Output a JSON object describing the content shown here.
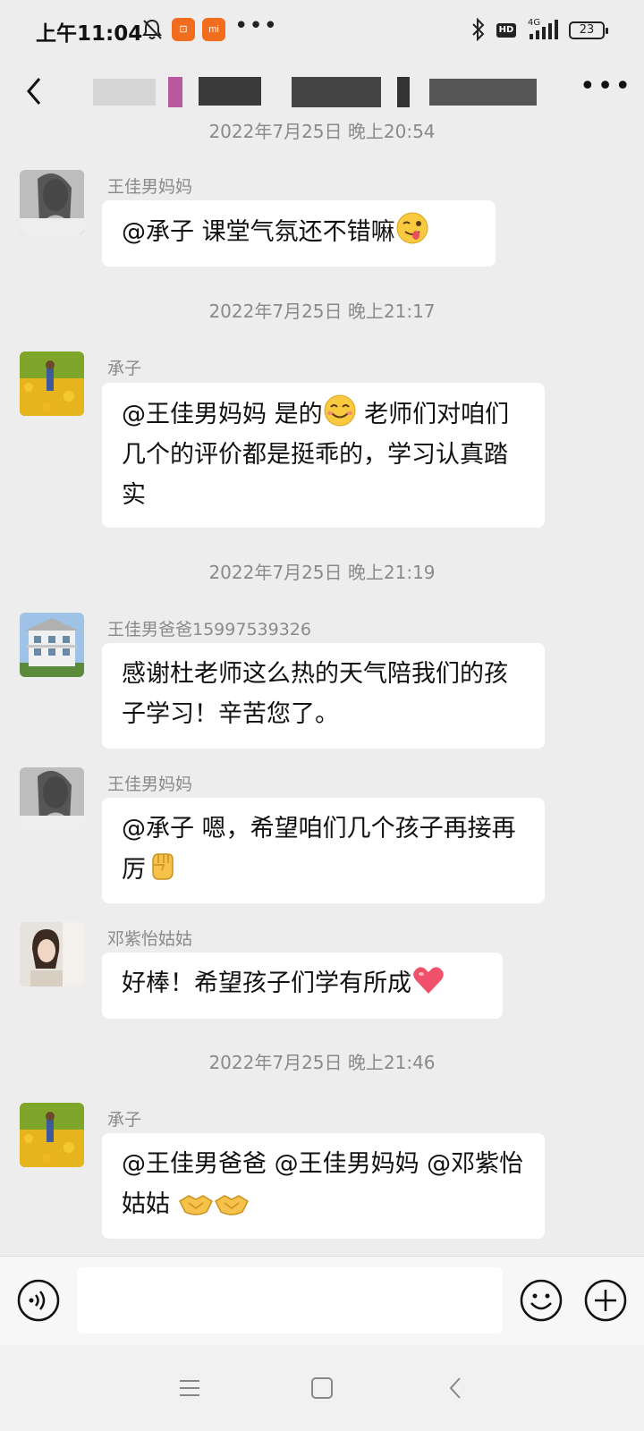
{
  "status_bar": {
    "time": "上午11:04",
    "shop_badge": "⊡",
    "mi_badge": "mi",
    "more": "•••",
    "hd": "HD",
    "network": "4G",
    "battery": "23"
  },
  "header": {
    "title": "",
    "more": "•••"
  },
  "messages": [
    {
      "type": "time",
      "text": "2022年7月25日 晚上20:54"
    },
    {
      "type": "msg",
      "sender": "王佳男妈妈",
      "text": "@承子  课堂气氛还不错嘛",
      "emoji": "wink-tongue-emoji"
    },
    {
      "type": "time",
      "text": "2022年7月25日 晚上21:17"
    },
    {
      "type": "msg",
      "sender": "承子",
      "text_before": "@王佳男妈妈  是的",
      "emoji": "smile-emoji",
      "text_after": "  老师们对咱们几个的评价都是挺乖的，学习认真踏实"
    },
    {
      "type": "time",
      "text": "2022年7月25日 晚上21:19"
    },
    {
      "type": "msg",
      "sender": "王佳男爸爸15997539326",
      "text": "感谢杜老师这么热的天气陪我们的孩子学习！辛苦您了。"
    },
    {
      "type": "msg",
      "sender": "王佳男妈妈",
      "text": "@承子  嗯，希望咱们几个孩子再接再厉",
      "emoji": "fist-emoji"
    },
    {
      "type": "msg",
      "sender": "邓紫怡姑姑",
      "text": "好棒！希望孩子们学有所成",
      "emoji": "heart-emoji"
    },
    {
      "type": "time",
      "text": "2022年7月25日 晚上21:46"
    },
    {
      "type": "msg",
      "sender": "承子",
      "text": "@王佳男爸爸 @王佳男妈妈 @邓紫怡姑姑 ",
      "emoji": "handshake-emoji"
    }
  ],
  "input": {
    "placeholder": "",
    "value": ""
  },
  "icons": {
    "voice": "voice-icon",
    "emoji": "smiley-icon",
    "plus": "plus-icon",
    "menu": "menu-icon",
    "home": "home-icon",
    "back": "back-icon"
  },
  "colors": {
    "background": "#ededed",
    "bubble": "#ffffff",
    "meta_text": "#8a8a8a"
  }
}
